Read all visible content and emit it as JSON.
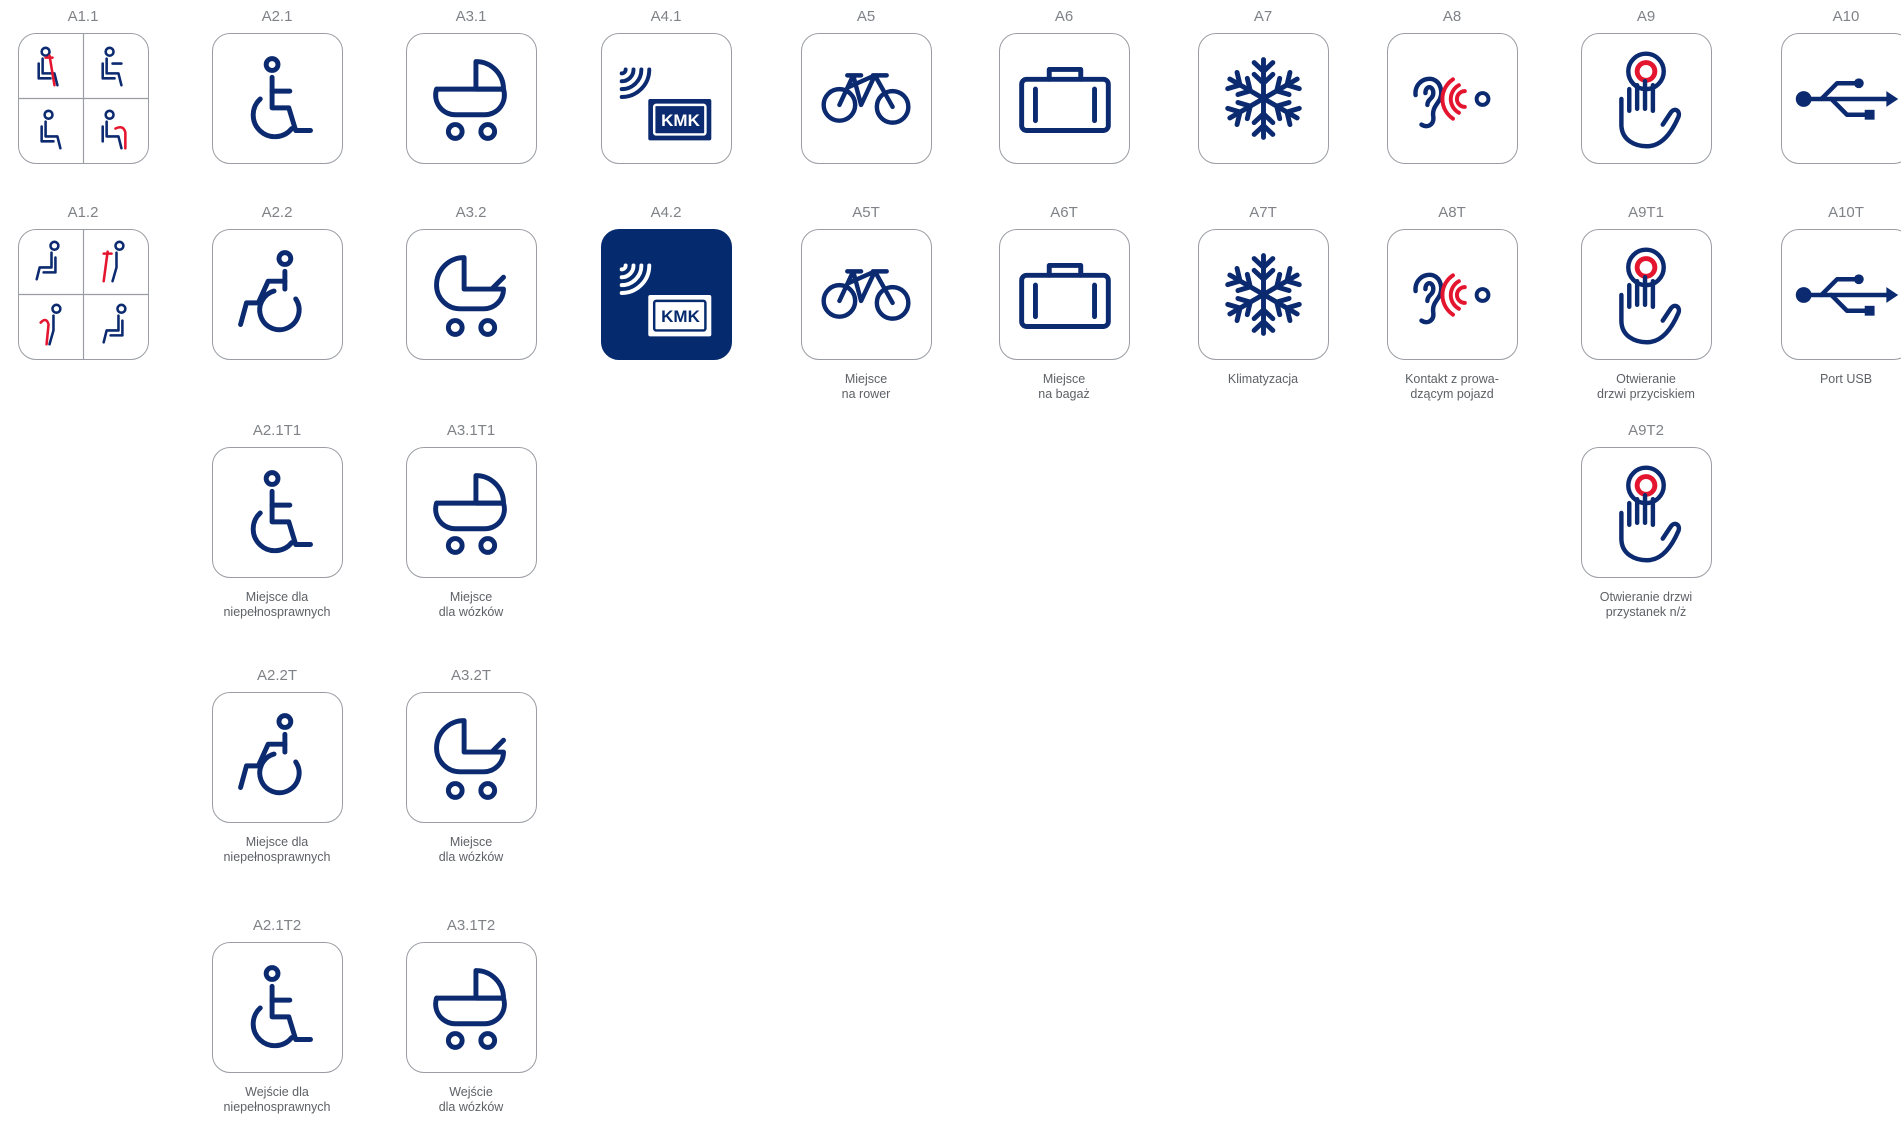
{
  "colors": {
    "primary": "#0b2a6f",
    "accent": "#e4162f",
    "outline": "#9a9da3",
    "label": "#7f8287",
    "caption": "#5e6167"
  },
  "icons": [
    {
      "code": "A1.1",
      "icon": "seats-quad-icon",
      "caption": ""
    },
    {
      "code": "A1.2",
      "icon": "seats-quad-icon",
      "caption": ""
    },
    {
      "code": "A2.1",
      "icon": "wheelchair-icon",
      "caption": ""
    },
    {
      "code": "A2.2",
      "icon": "wheelchair-active-icon",
      "caption": ""
    },
    {
      "code": "A2.1T1",
      "icon": "wheelchair-icon",
      "caption": "Miejsce dla\nniepełnosprawnych"
    },
    {
      "code": "A2.2T",
      "icon": "wheelchair-active-icon",
      "caption": "Miejsce dla\nniepełnosprawnych"
    },
    {
      "code": "A2.1T2",
      "icon": "wheelchair-icon",
      "caption": "Wejście dla\nniepełnosprawnych"
    },
    {
      "code": "A3.1",
      "icon": "pram-icon",
      "caption": ""
    },
    {
      "code": "A3.2",
      "icon": "stroller-icon",
      "caption": ""
    },
    {
      "code": "A3.1T1",
      "icon": "pram-icon",
      "caption": "Miejsce\ndla wózków"
    },
    {
      "code": "A3.2T",
      "icon": "stroller-icon",
      "caption": "Miejsce\ndla wózków"
    },
    {
      "code": "A3.1T2",
      "icon": "pram-icon",
      "caption": "Wejście\ndla wózków"
    },
    {
      "code": "A4.1",
      "icon": "kmk-card-reader-icon",
      "caption": "",
      "card_text": "KMK"
    },
    {
      "code": "A4.2",
      "icon": "kmk-card-reader-icon",
      "caption": "",
      "card_text": "KMK"
    },
    {
      "code": "A5",
      "icon": "bicycle-icon",
      "caption": ""
    },
    {
      "code": "A5T",
      "icon": "bicycle-icon",
      "caption": "Miejsce\nna rower"
    },
    {
      "code": "A6",
      "icon": "suitcase-icon",
      "caption": ""
    },
    {
      "code": "A6T",
      "icon": "suitcase-icon",
      "caption": "Miejsce\nna bagaż"
    },
    {
      "code": "A7",
      "icon": "snowflake-icon",
      "caption": ""
    },
    {
      "code": "A7T",
      "icon": "snowflake-icon",
      "caption": "Klimatyzacja"
    },
    {
      "code": "A8",
      "icon": "ear-signal-icon",
      "caption": ""
    },
    {
      "code": "A8T",
      "icon": "ear-signal-icon",
      "caption": "Kontakt z prowa-\ndzącym pojazd"
    },
    {
      "code": "A9",
      "icon": "hand-button-icon",
      "caption": ""
    },
    {
      "code": "A9T1",
      "icon": "hand-button-icon",
      "caption": "Otwieranie\ndrzwi przyciskiem"
    },
    {
      "code": "A9T2",
      "icon": "hand-button-icon",
      "caption": "Otwieranie drzwi\nprzystanek n/ż"
    },
    {
      "code": "A10",
      "icon": "usb-icon",
      "caption": ""
    },
    {
      "code": "A10T",
      "icon": "usb-icon",
      "caption": "Port USB"
    }
  ]
}
